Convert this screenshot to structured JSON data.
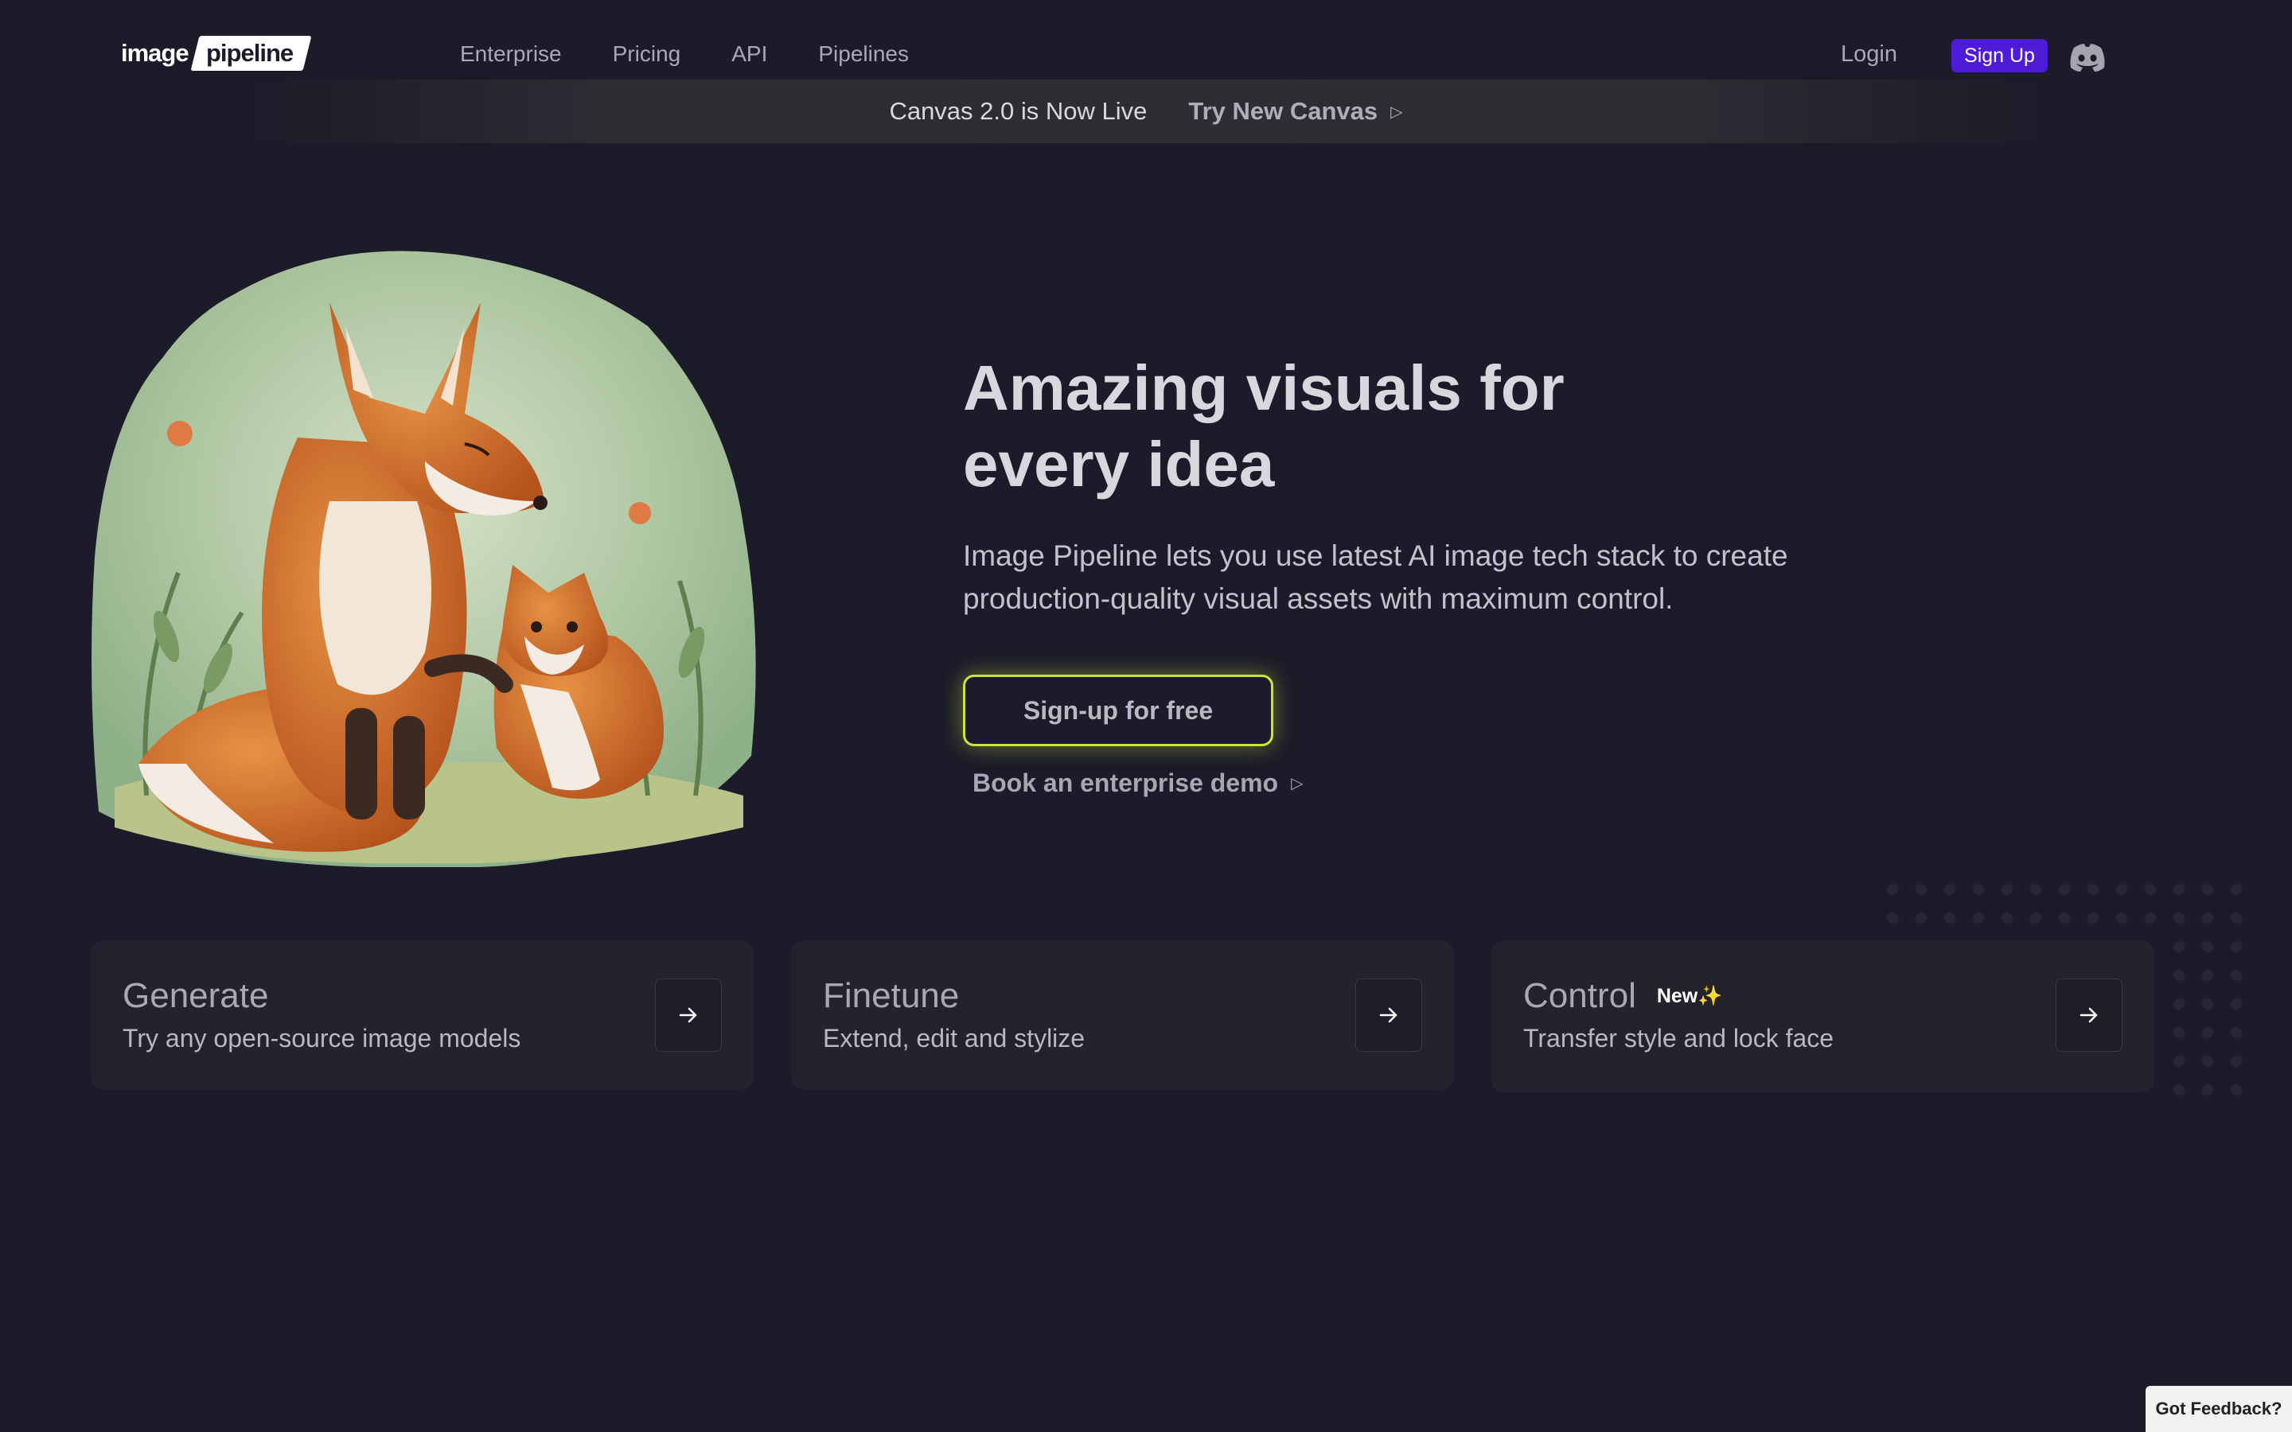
{
  "header": {
    "logo_left": "image",
    "logo_right": "pipeline",
    "nav": [
      "Enterprise",
      "Pricing",
      "API",
      "Pipelines"
    ],
    "login_label": "Login",
    "signup_label": "Sign Up",
    "discord_icon": "discord-icon"
  },
  "announcement": {
    "text": "Canvas 2.0 is Now Live",
    "link_label": "Try New Canvas",
    "link_icon": "▷"
  },
  "hero": {
    "headline_line1": "Amazing visuals for",
    "headline_line2": "every idea",
    "subtext_line1": "Image Pipeline lets you use latest AI image tech stack to create",
    "subtext_line2": "production-quality visual assets with maximum control.",
    "cta_label": "Sign-up for free",
    "demo_label": "Book an enterprise demo",
    "demo_icon": "▷",
    "cta_glow_color": "#c9e43f"
  },
  "cards": [
    {
      "title": "Generate",
      "desc": "Try any open-source image models",
      "badge": ""
    },
    {
      "title": "Finetune",
      "desc": "Extend, edit and stylize",
      "badge": ""
    },
    {
      "title": "Control",
      "desc": "Transfer style and lock face",
      "badge": "New✨"
    }
  ],
  "feedback_label": "Got Feedback?",
  "colors": {
    "background": "#1b1b29",
    "accent": "#4e1bd9",
    "card": "#23232f"
  }
}
